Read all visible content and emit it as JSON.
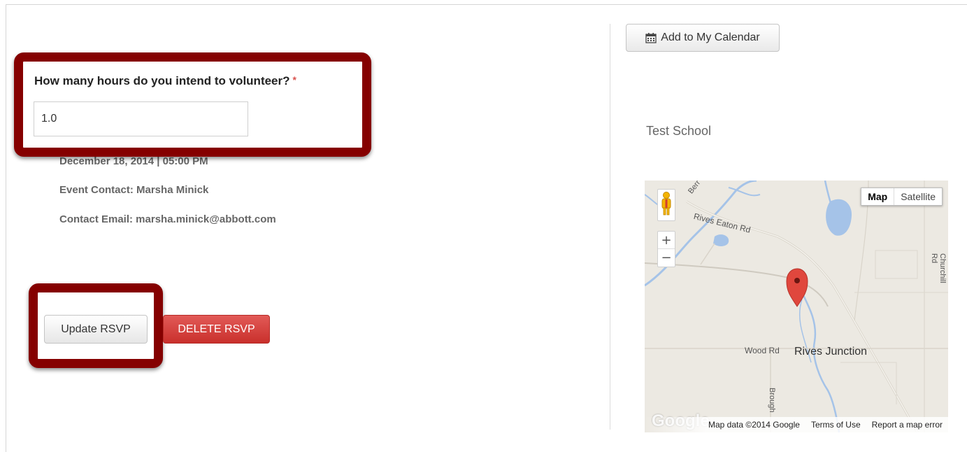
{
  "form": {
    "question_label": "How many hours do you intend to volunteer?",
    "required_mark": "*",
    "hours_value": "1.0"
  },
  "event": {
    "date_time": "December 18, 2014 | 05:00 PM",
    "contact": "Event Contact: Marsha Minick",
    "contact_email": "Contact Email: marsha.minick@abbott.com"
  },
  "actions": {
    "update_label": "Update RSVP",
    "delete_label": "DELETE RSVP"
  },
  "sidebar": {
    "calendar_label": "Add to My Calendar",
    "location_name": "Test School"
  },
  "map": {
    "type_map": "Map",
    "type_satellite": "Satellite",
    "zoom_in": "+",
    "zoom_out": "−",
    "labels": {
      "rives_eaton": "Rives Eaton Rd",
      "berry": "Berr",
      "wood": "Wood Rd",
      "rives_junction": "Rives Junction",
      "churchill": "Churchill Rd",
      "brough": "Brough"
    },
    "logo": "Google",
    "footer": {
      "data": "Map data ©2014 Google",
      "terms": "Terms of Use",
      "report": "Report a map error"
    }
  },
  "colors": {
    "highlight": "#850000",
    "delete": "#d43f3a",
    "water": "#a5c3e8"
  }
}
